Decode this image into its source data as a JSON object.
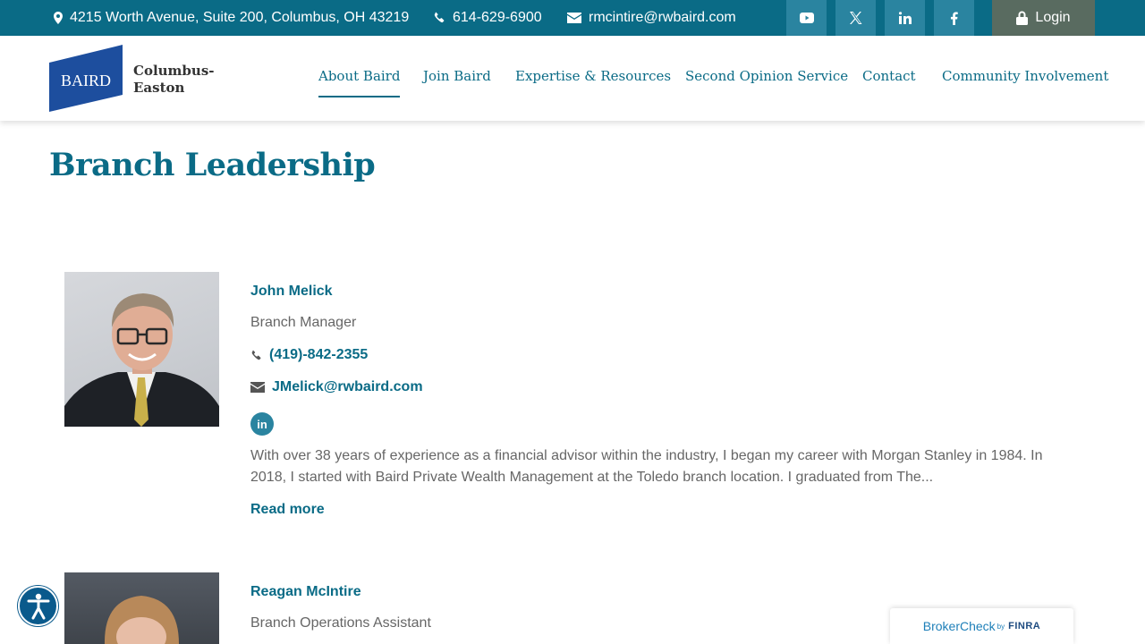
{
  "topbar": {
    "address": "4215 Worth Avenue, Suite 200, Columbus, OH 43219",
    "phone": "614-629-6900",
    "email": "rmcintire@rwbaird.com",
    "social": [
      "youtube-icon",
      "x-icon",
      "linkedin-icon",
      "facebook-icon"
    ],
    "login_label": "Login"
  },
  "logo": {
    "brand": "BAIRD",
    "line1": "Columbus-",
    "line2": "Easton"
  },
  "nav": {
    "items": [
      {
        "label": "About Baird",
        "active": true
      },
      {
        "label": "Join Baird"
      },
      {
        "label": "Expertise & Resources"
      },
      {
        "label": "Second Opinion Service"
      },
      {
        "label": "Contact"
      },
      {
        "label": "Community Involvement"
      }
    ]
  },
  "page": {
    "title": "Branch Leadership"
  },
  "people": [
    {
      "name": "John Melick",
      "role": "Branch Manager",
      "phone": "(419)-842-2355",
      "email": "JMelick@rwbaird.com",
      "linkedin": "in",
      "bio": "With over 38 years of experience as a financial advisor within the industry, I began my career with Morgan Stanley in 1984. In 2018, I started with Baird Private Wealth Management at the Toledo branch location. I graduated from The...",
      "read_more": "Read more"
    },
    {
      "name": "Reagan McIntire",
      "role": "Branch Operations Assistant"
    }
  ],
  "broker_check": {
    "label": "BrokerCheck",
    "by": "by",
    "org": "FINRA"
  },
  "colors": {
    "primary": "#0a6b86",
    "topbar": "#0a6b86",
    "social_bg": "#2a84a0",
    "login_bg": "#596b60"
  }
}
